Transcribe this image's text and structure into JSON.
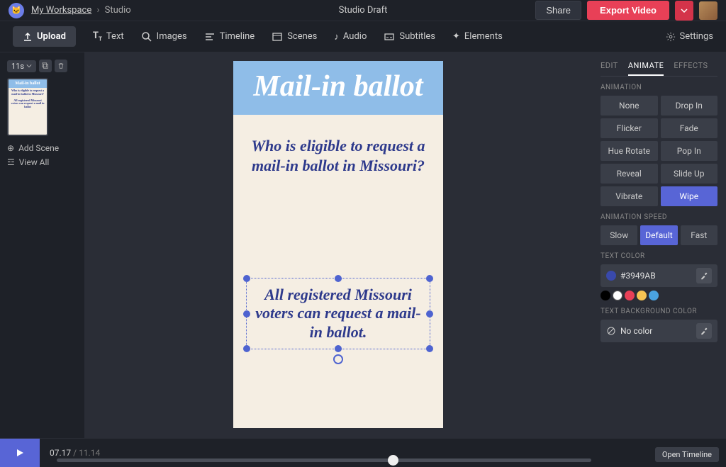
{
  "breadcrumb": {
    "workspace": "My Workspace",
    "studio": "Studio"
  },
  "project_name": "Studio Draft",
  "topbar": {
    "share": "Share",
    "export": "Export Video"
  },
  "toolbar": {
    "upload": "Upload",
    "items": [
      {
        "label": "Text"
      },
      {
        "label": "Images"
      },
      {
        "label": "Timeline"
      },
      {
        "label": "Scenes"
      },
      {
        "label": "Audio"
      },
      {
        "label": "Subtitles"
      },
      {
        "label": "Elements"
      }
    ],
    "settings": "Settings"
  },
  "left": {
    "duration": "11s",
    "add_scene": "Add Scene",
    "view_all": "View All",
    "thumb": {
      "title": "Mail-in ballot",
      "q": "Who is eligible to request a mail-in ballot in Missouri?",
      "a": "All registered Missouri voters can request a mail in ballot"
    }
  },
  "canvas": {
    "title": "Mail-in ballot",
    "question": "Who is eligible to request a mail-in ballot in Missouri?",
    "answer": "All registered Missouri voters can request a mail-in ballot."
  },
  "right": {
    "tabs": {
      "edit": "EDIT",
      "animate": "ANIMATE",
      "effects": "EFFECTS"
    },
    "animation_label": "ANIMATION",
    "animations": [
      "None",
      "Drop In",
      "Flicker",
      "Fade",
      "Hue Rotate",
      "Pop In",
      "Reveal",
      "Slide Up",
      "Vibrate",
      "Wipe"
    ],
    "active_animation": "Wipe",
    "speed_label": "ANIMATION SPEED",
    "speeds": [
      "Slow",
      "Default",
      "Fast"
    ],
    "active_speed": "Default",
    "text_color_label": "TEXT COLOR",
    "text_color": "#3949AB",
    "swatches": [
      "#000000",
      "#ffffff",
      "#e84057",
      "#f5c453",
      "#4aa3e0"
    ],
    "bg_color_label": "TEXT BACKGROUND COLOR",
    "no_color": "No color"
  },
  "timeline": {
    "current": "07.17",
    "total": "11.14",
    "open": "Open Timeline"
  }
}
